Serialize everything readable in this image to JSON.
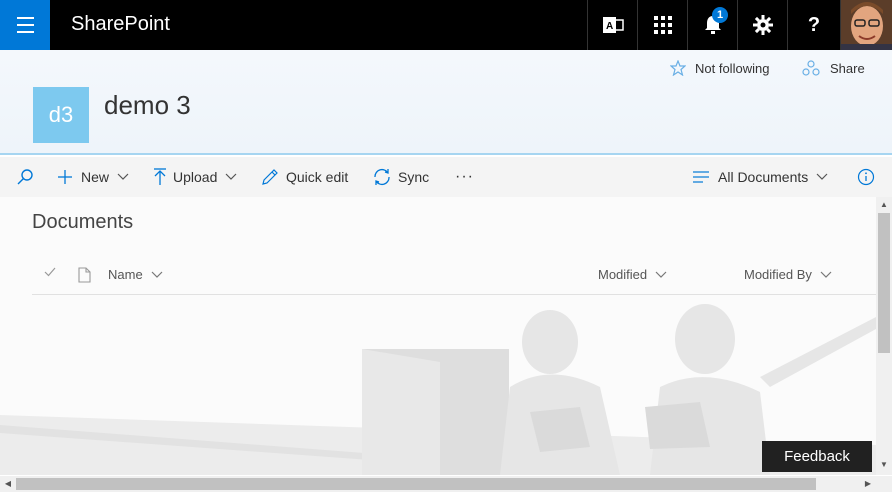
{
  "suite": {
    "app_name": "SharePoint",
    "notification_count": "1"
  },
  "header": {
    "follow_label": "Not following",
    "share_label": "Share",
    "site_logo_text": "d3",
    "site_title": "demo 3"
  },
  "commands": {
    "new_label": "New",
    "upload_label": "Upload",
    "quick_edit_label": "Quick edit",
    "sync_label": "Sync",
    "more_label": "···",
    "view_label": "All Documents"
  },
  "library": {
    "title": "Documents",
    "columns": {
      "name": "Name",
      "modified": "Modified",
      "modified_by": "Modified By"
    }
  },
  "feedback_label": "Feedback",
  "colors": {
    "suite_bar": "#000000",
    "waffle": "#0078d7",
    "accent": "#0078d7",
    "site_logo": "#7dc9ef"
  }
}
